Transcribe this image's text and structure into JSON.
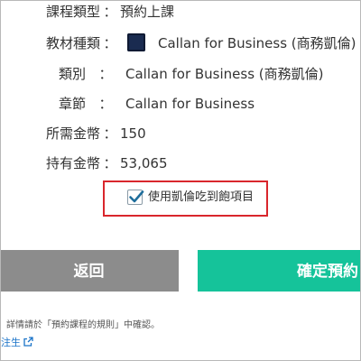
{
  "fields": {
    "course_type": {
      "label": "課程類型",
      "sep": "：",
      "value": "預約上課"
    },
    "material_type": {
      "label": "教材種類",
      "sep": "：",
      "value": "Callan for Business (商務凱倫)",
      "icon": "book-cover-icon"
    },
    "category": {
      "label": "類別",
      "sep": "：",
      "value": "Callan for Business (商務凱倫)"
    },
    "chapter": {
      "label": "章節",
      "sep": "：",
      "value": "Callan for Business"
    },
    "required_coins": {
      "label": "所需金幣",
      "sep": "：",
      "value": "150"
    },
    "owned_coins": {
      "label": "持有金幣",
      "sep": "：",
      "value": "53,065"
    }
  },
  "checkbox": {
    "label": "使用凱倫吃到飽項目",
    "checked": true
  },
  "buttons": {
    "back": "返回",
    "confirm": "確定預約"
  },
  "footer": {
    "note": "詳情請於「預約課程的規則」中確認。",
    "link": "注生"
  },
  "colors": {
    "back_button": "#8c8c8c",
    "confirm_button": "#15c39a",
    "highlight_border": "#d9262c",
    "link": "#1a73c8"
  }
}
